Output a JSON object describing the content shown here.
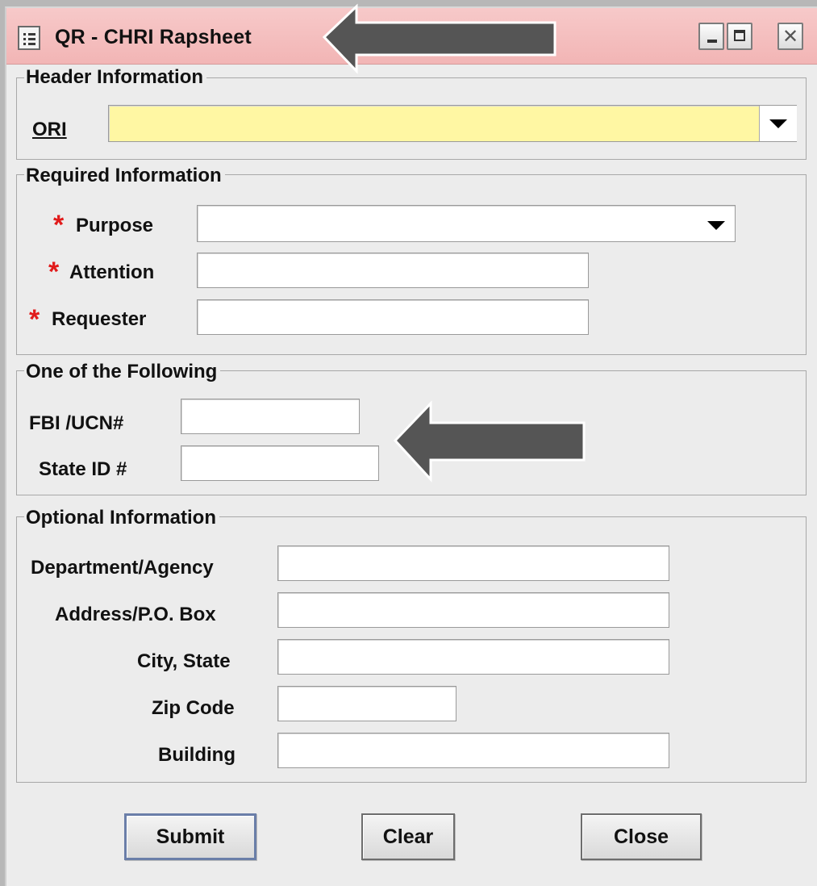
{
  "window": {
    "title": "QR - CHRI Rapsheet",
    "icons": [
      "form-icon",
      "minimize-icon",
      "maximize-icon",
      "close-icon"
    ]
  },
  "header_info": {
    "legend": "Header Information",
    "ori": {
      "label": "ORI",
      "value": ""
    }
  },
  "required_info": {
    "legend": "Required Information",
    "required_marker": "*",
    "purpose": {
      "label": "Purpose",
      "value": ""
    },
    "attention": {
      "label": "Attention",
      "value": ""
    },
    "requester": {
      "label": "Requester",
      "value": ""
    }
  },
  "one_of_following": {
    "legend": "One of the Following",
    "fbi_ucn": {
      "label": "FBI /UCN#",
      "value": ""
    },
    "state_id": {
      "label": "State ID #",
      "value": ""
    }
  },
  "optional_info": {
    "legend": "Optional Information",
    "department": {
      "label": "Department/Agency",
      "value": ""
    },
    "address": {
      "label": "Address/P.O. Box",
      "value": ""
    },
    "city_state": {
      "label": "City, State",
      "value": ""
    },
    "zip": {
      "label": "Zip Code",
      "value": ""
    },
    "building": {
      "label": "Building",
      "value": ""
    }
  },
  "buttons": {
    "submit": "Submit",
    "clear": "Clear",
    "close": "Close"
  },
  "colors": {
    "titlebar": "#f2b5b5",
    "required_field": "#fff7a3",
    "required_marker": "#e11b1b",
    "annotation_arrow": "#555555"
  }
}
